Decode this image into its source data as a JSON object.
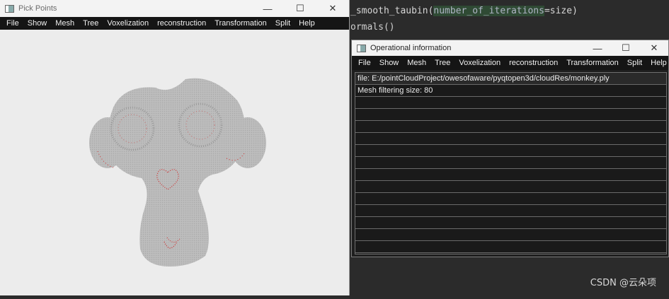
{
  "editor": {
    "line1_fn": "_smooth_taubin(",
    "line1_param": "number_of_iterations",
    "line1_val": "=size)",
    "line2": "ormals()",
    "watermark": "CSDN @云朵项"
  },
  "pick_window": {
    "title": "Pick Points",
    "menu": [
      "File",
      "Show",
      "Mesh",
      "Tree",
      "Voxelization",
      "reconstruction",
      "Transformation",
      "Split",
      "Help"
    ]
  },
  "op_window": {
    "title": "Operational information",
    "menu": [
      "File",
      "Show",
      "Mesh",
      "Tree",
      "Voxelization",
      "reconstruction",
      "Transformation",
      "Split",
      "Help"
    ],
    "rows": [
      "file:  E:/pointCloudProject/owesofaware/pyqtopen3d/cloudRes/monkey.ply",
      "Mesh filtering size:  80",
      "",
      "",
      "",
      "",
      "",
      "",
      "",
      "",
      "",
      "",
      "",
      "",
      ""
    ]
  },
  "window_controls": {
    "minimize": "—",
    "maximize": "☐",
    "close": "✕"
  },
  "colors": {
    "mesh_gray": "#b9b9b9",
    "mesh_red": "#d23030",
    "menubar": "#151515"
  }
}
